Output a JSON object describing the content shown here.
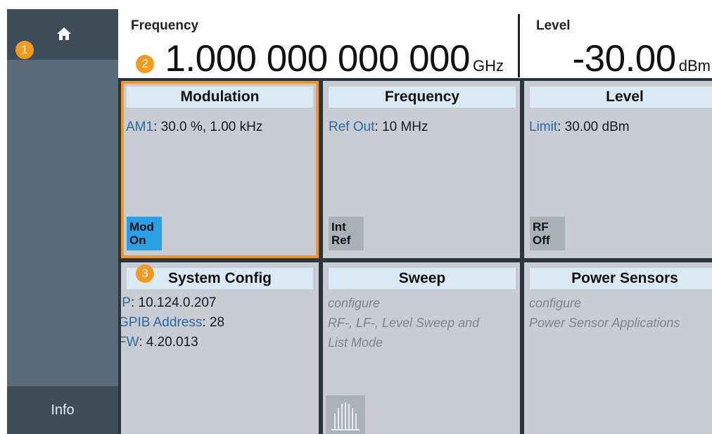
{
  "markers": [
    "1",
    "2",
    "3"
  ],
  "sidebar": {
    "home_icon": "home-icon",
    "info_label": "Info"
  },
  "header": {
    "frequency": {
      "label": "Frequency",
      "value": "1.000 000 000 000",
      "unit": "GHz"
    },
    "level": {
      "label": "Level",
      "value": "-30.00",
      "unit": "dBm"
    }
  },
  "tiles": {
    "modulation": {
      "title": "Modulation",
      "line1_key": "AM1",
      "line1_val": ": 30.0 %, 1.00 kHz",
      "btn_top": "Mod",
      "btn_bottom": "On"
    },
    "frequency": {
      "title": "Frequency",
      "line1_key": "Ref Out",
      "line1_val": ": 10 MHz",
      "btn_top": "Int",
      "btn_bottom": "Ref"
    },
    "level": {
      "title": "Level",
      "line1_key": "Limit",
      "line1_val": ": 30.00 dBm",
      "btn_top": "RF",
      "btn_bottom": "Off"
    },
    "system_config": {
      "title": "System Config",
      "rows": [
        {
          "key": "IP",
          "val": ": 10.124.0.207"
        },
        {
          "key": "GPIB Address",
          "val": ": 28"
        },
        {
          "key": "FW",
          "val": ": 4.20.013"
        }
      ]
    },
    "sweep": {
      "title": "Sweep",
      "line1": "configure",
      "line2": "RF-, LF-, Level Sweep and",
      "line3": "List Mode",
      "icon": "sweep-icon"
    },
    "power_sensors": {
      "title": "Power Sensors",
      "line1": "configure",
      "line2": "Power Sensor Applications"
    }
  },
  "colors": {
    "accent": "#f29a1f",
    "on_button": "#2ba0e8",
    "key_text": "#2a6aa0",
    "title_bar": "#dbe9f4"
  }
}
